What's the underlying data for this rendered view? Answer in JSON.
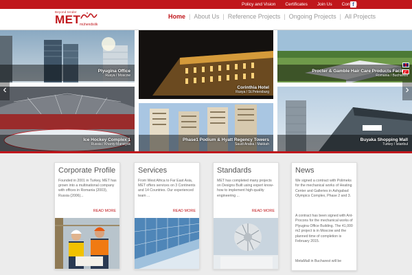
{
  "topbar": {
    "links": [
      "Policy and Vision",
      "Certificates",
      "Join Us",
      "Contact"
    ],
    "facebook_icon": "facebook-icon"
  },
  "logo": {
    "tagline": "Beyond tender",
    "name": "MET",
    "subtitle": "mühendislik"
  },
  "nav": {
    "items": [
      "Home",
      "About Us",
      "Reference Projects",
      "Ongoing Projects",
      "All Projects"
    ],
    "active": "Home"
  },
  "gallery": {
    "slides": [
      {
        "title": "Plyugina Office",
        "location": "Rusya / Moscow"
      },
      {
        "title": "Corinthia Hotel",
        "location": "Rusya / St.Petersburg"
      },
      {
        "title": "Procter & Gamble Hair Care Products Facility",
        "location": "Romania / Bucharest"
      },
      {
        "title": "Ice Hockey Complex 1",
        "location": "Russia / Khanty-Mansiysk"
      },
      {
        "title": "Phase1 Podium & Hyatt Regency Towers",
        "location": "Saudi Arabia / Makkah"
      },
      {
        "title": "Buyaka Shopping Mall",
        "location": "Turkey / Istanbul"
      }
    ],
    "prev_icon": "chevron-left-icon",
    "next_icon": "chevron-right-icon",
    "flags": [
      "english-flag-icon",
      "turkish-flag-icon"
    ]
  },
  "cards": [
    {
      "title": "Corporate Profile",
      "body": "Founded in 2001 in Turkey, MET has grown into a multinational company with offices in Romania (2003), Russia (2006)...",
      "more": "READ MORE"
    },
    {
      "title": "Services",
      "body": "From West Africa to Far East Asia, MET offers services on 3 Continents and 14 Countries. Our experienced team ...",
      "more": "READ MORE"
    },
    {
      "title": "Standards",
      "body": "MET has completed many projects on Designs Built using expert know-how to implement high-quality engineering ...",
      "more": "READ MORE"
    }
  ],
  "news": {
    "title": "News",
    "items": [
      "We signed a contract with Polimeks for the mechanical works of Heating Center and Galleries in Ashgabad Olympics Complex, Phase 2 and 3.",
      "A contract has been signed with Ant-Procons for the mechanical works of Plyugina Office Building. The 41,000 m2 project is in Moscow and the planned time of completion is February 2015.",
      "MetaMall in Bucharest will be"
    ]
  },
  "colors": {
    "brand_red": "#c0171c",
    "nav_gray": "#999999",
    "page_bg": "#ececec"
  }
}
